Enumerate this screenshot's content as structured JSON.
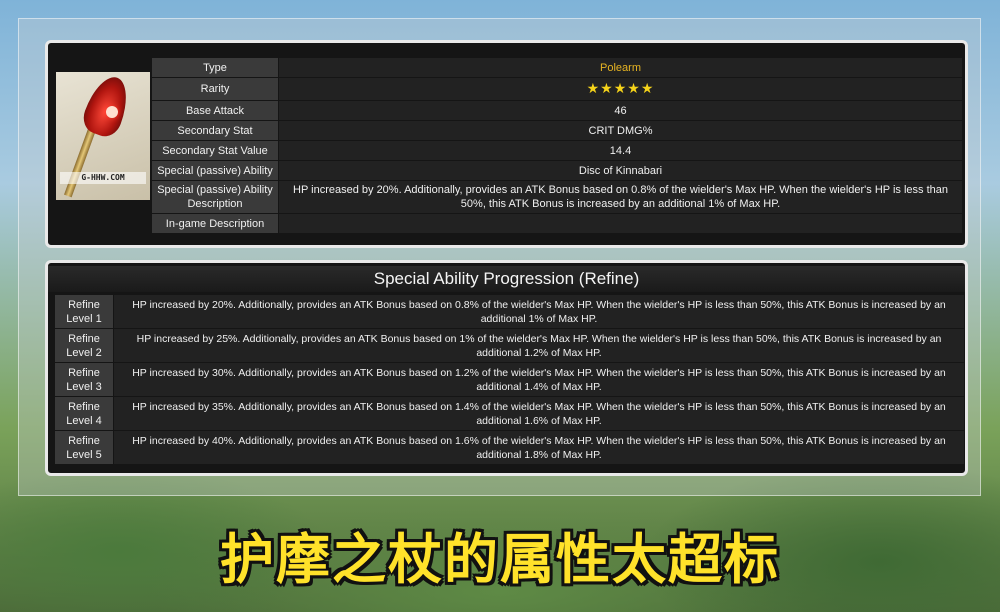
{
  "stats": {
    "watermark": "G-HHW.COM",
    "rows": [
      {
        "label": "Type",
        "value": "Polearm"
      },
      {
        "label": "Rarity",
        "value": "★★★★★"
      },
      {
        "label": "Base Attack",
        "value": "46"
      },
      {
        "label": "Secondary Stat",
        "value": "CRIT DMG%"
      },
      {
        "label": "Secondary Stat Value",
        "value": "14.4"
      },
      {
        "label": "Special (passive) Ability",
        "value": "Disc of Kinnabari"
      },
      {
        "label": "Special (passive) Ability Description",
        "value": "HP increased by 20%. Additionally, provides an ATK Bonus based on 0.8% of the wielder's Max HP. When the wielder's HP is less than 50%, this ATK Bonus is increased by an additional 1% of Max HP."
      },
      {
        "label": "In-game Description",
        "value": ""
      }
    ],
    "colors": {
      "type_value": "#e6b422",
      "stars": "#f5d31a"
    }
  },
  "refine": {
    "title": "Special Ability Progression (Refine)",
    "levels": [
      {
        "level": "Refine Level 1",
        "desc": "HP increased by 20%. Additionally, provides an ATK Bonus based on 0.8% of the wielder's Max HP. When the wielder's HP is less than 50%, this ATK Bonus is increased by an additional 1% of Max HP."
      },
      {
        "level": "Refine Level 2",
        "desc": "HP increased by 25%. Additionally, provides an ATK Bonus based on 1% of the wielder's Max HP. When the wielder's HP is less than 50%, this ATK Bonus is increased by an additional 1.2% of Max HP."
      },
      {
        "level": "Refine Level 3",
        "desc": "HP increased by 30%. Additionally, provides an ATK Bonus based on 1.2% of the wielder's Max HP. When the wielder's HP is less than 50%, this ATK Bonus is increased by an additional 1.4% of Max HP."
      },
      {
        "level": "Refine Level 4",
        "desc": "HP increased by 35%. Additionally, provides an ATK Bonus based on 1.4% of the wielder's Max HP. When the wielder's HP is less than 50%, this ATK Bonus is increased by an additional 1.6% of Max HP."
      },
      {
        "level": "Refine Level 5",
        "desc": "HP increased by 40%. Additionally, provides an ATK Bonus based on 1.6% of the wielder's Max HP. When the wielder's HP is less than 50%, this ATK Bonus is increased by an additional 1.8% of Max HP."
      }
    ]
  },
  "banner": {
    "text": "护摩之杖的属性太超标",
    "color": "#ffe22a"
  }
}
